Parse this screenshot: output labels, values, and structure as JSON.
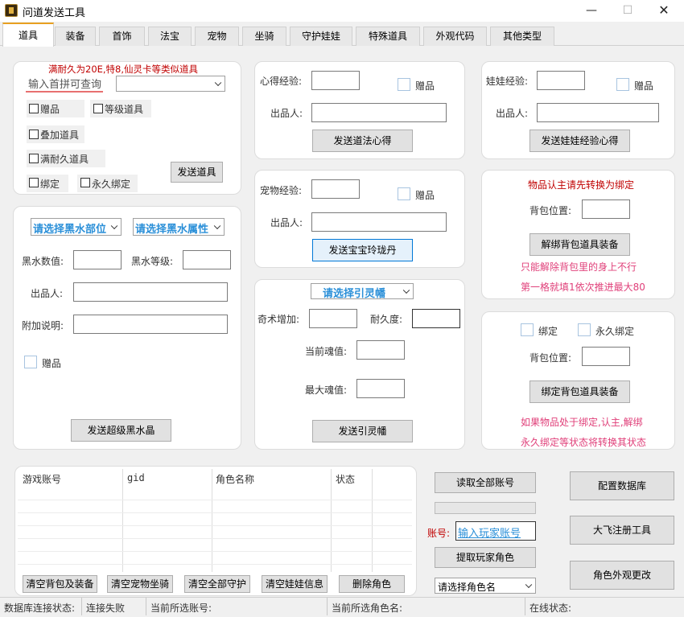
{
  "window": {
    "title": "问道发送工具",
    "minimize": "—",
    "maximize": "☐",
    "close": "✕"
  },
  "tabs": [
    "道具",
    "装备",
    "首饰",
    "法宝",
    "宠物",
    "坐骑",
    "守护娃娃",
    "特殊道具",
    "外观代码",
    "其他类型"
  ],
  "item_panel": {
    "notice": "满耐久为20E,特8,仙灵卡等类似道具",
    "search_label": "输入首拼可查询",
    "gift": "赠品",
    "level_item": "等级道具",
    "stack_item": "叠加道具",
    "full_durability": "满耐久道具",
    "bind": "绑定",
    "perm_bind": "永久绑定",
    "send_button": "发送道具"
  },
  "xinde_panel": {
    "exp_label": "心得经验:",
    "gift": "赠品",
    "producer_label": "出品人:",
    "send_button": "发送道法心得"
  },
  "doll_panel": {
    "exp_label": "娃娃经验:",
    "gift": "赠品",
    "producer_label": "出品人:",
    "send_button": "发送娃娃经验心得"
  },
  "pet_panel": {
    "exp_label": "宠物经验:",
    "gift": "赠品",
    "producer_label": "出品人:",
    "send_button": "发送宝宝玲珑丹"
  },
  "unbind_panel": {
    "title": "物品认主请先转换为绑定",
    "slot_label": "背包位置:",
    "button": "解绑背包道具装备",
    "hint1": "只能解除背包里的身上不行",
    "hint2": "第一格就填1依次推进最大80"
  },
  "blackwater_panel": {
    "part_select": "请选择黑水部位",
    "attr_select": "请选择黑水属性",
    "value_label": "黑水数值:",
    "level_label": "黑水等级:",
    "producer_label": "出品人:",
    "note_label": "附加说明:",
    "gift": "赠品",
    "send_button": "发送超级黑水晶"
  },
  "soul_panel": {
    "select": "请选择引灵幡",
    "skill_label": "奇术增加:",
    "durability_label": "耐久度:",
    "cur_soul_label": "当前魂值:",
    "max_soul_label": "最大魂值:",
    "send_button": "发送引灵幡"
  },
  "bind_panel": {
    "bind": "绑定",
    "perm_bind": "永久绑定",
    "slot_label": "背包位置:",
    "button": "绑定背包道具装备",
    "hint1": "如果物品处于绑定,认主,解绑",
    "hint2": "永久绑定等状态将转换其状态"
  },
  "table": {
    "columns": [
      "游戏账号",
      "gid",
      "角色名称",
      "状态"
    ]
  },
  "table_buttons": [
    "清空背包及装备",
    "清空宠物坐骑",
    "清空全部守护",
    "清空娃娃信息",
    "删除角色"
  ],
  "account": {
    "read_all": "读取全部账号",
    "account_label": "账号:",
    "account_input": "输入玩家账号",
    "fetch_role": "提取玩家角色",
    "role_select": "请选择角色名"
  },
  "right_buttons": [
    "配置数据库",
    "大飞注册工具",
    "角色外观更改"
  ],
  "statusbar": {
    "db_label": "数据库连接状态:",
    "db_value": "连接失败",
    "account_label": "当前所选账号:",
    "role_label": "当前所选角色名:",
    "online_label": "在线状态:"
  }
}
